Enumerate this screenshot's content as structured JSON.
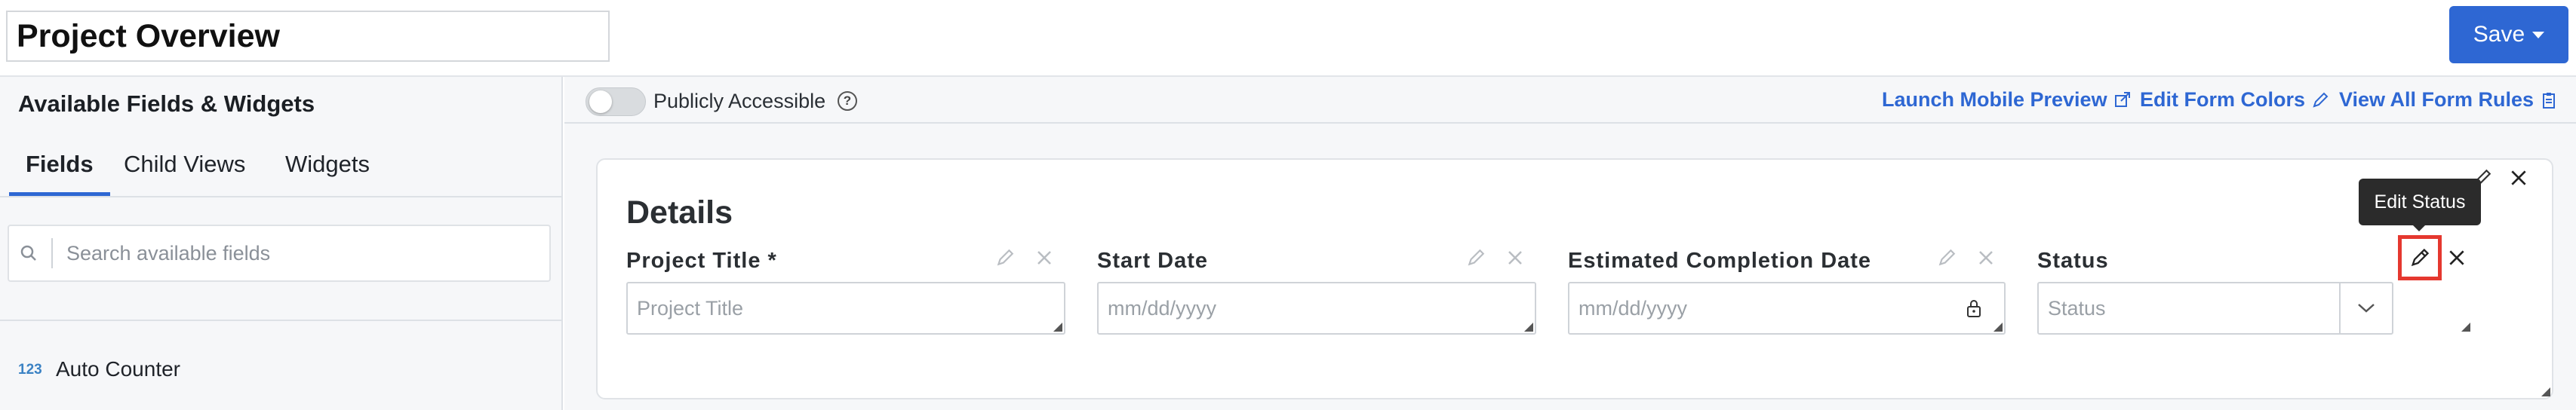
{
  "header": {
    "title": "Project Overview",
    "save_label": "Save",
    "save_color": "#2e67d3"
  },
  "sidebar": {
    "title": "Available Fields & Widgets",
    "tabs": [
      {
        "label": "Fields",
        "active": true
      },
      {
        "label": "Child Views",
        "active": false
      },
      {
        "label": "Widgets",
        "active": false
      }
    ],
    "search": {
      "placeholder": "Search available fields",
      "value": ""
    },
    "items": [
      {
        "badge": "123",
        "label": "Auto Counter"
      }
    ]
  },
  "toolbar": {
    "publicly_accessible_label": "Publicly Accessible",
    "publicly_accessible_on": false,
    "launch_mobile_preview": "Launch Mobile Preview",
    "edit_form_colors": "Edit Form Colors",
    "view_all_form_rules": "View All Form Rules",
    "link_color": "#2e67d3"
  },
  "form": {
    "section_title": "Details",
    "fields": [
      {
        "label": "Project Title *",
        "placeholder": "Project Title",
        "icons": [
          "pencil-icon",
          "close-icon"
        ]
      },
      {
        "label": "Start Date",
        "placeholder": "mm/dd/yyyy",
        "icons": [
          "pencil-icon",
          "close-icon"
        ]
      },
      {
        "label": "Estimated Completion Date",
        "placeholder": "mm/dd/yyyy",
        "icons": [
          "pencil-icon",
          "close-icon",
          "lock-icon"
        ]
      },
      {
        "label": "Status",
        "placeholder": "Status",
        "icons": [
          "pencil-icon",
          "close-icon",
          "chevron-down-icon"
        ]
      }
    ],
    "tooltip": "Edit Status",
    "highlight_color": "#e5382f"
  }
}
